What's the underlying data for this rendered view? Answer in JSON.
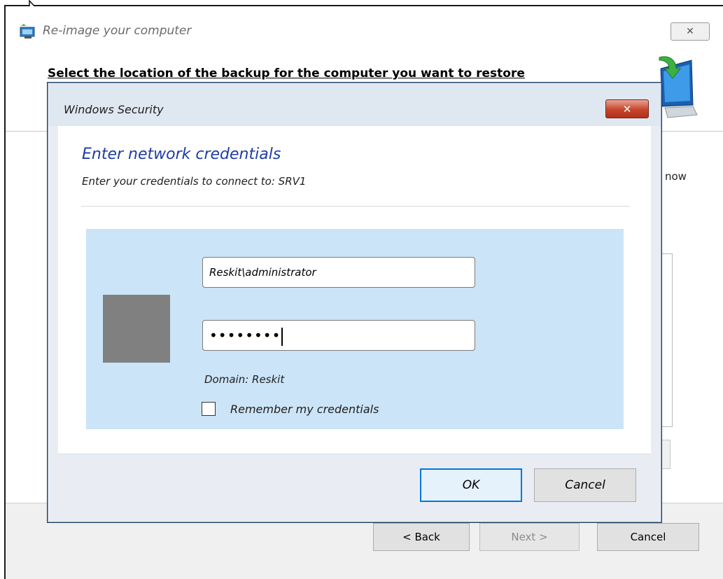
{
  "background_window": {
    "title": "Re-image your computer",
    "close_glyph": "✕",
    "heading": "Select the location of the backup for the computer you want to restore",
    "partial_text": "now",
    "buttons": {
      "back": "< Back",
      "next": "Next >",
      "cancel": "Cancel"
    }
  },
  "dialog": {
    "title": "Windows Security",
    "close_glyph": "✕",
    "heading": "Enter network credentials",
    "subheading": "Enter your credentials to connect to: SRV1",
    "username_value": "Reskit\\administrator",
    "password_mask": "••••••••",
    "domain_text": "Domain: Reskit",
    "remember_label": "Remember my credentials",
    "remember_checked": false,
    "ok_label": "OK",
    "cancel_label": "Cancel"
  },
  "colors": {
    "heading_blue": "#1f3da3",
    "panel_blue": "#cce4f7",
    "close_red": "#c7442b",
    "ok_border": "#0078d7"
  },
  "icons": [
    "window-app-icon",
    "computer-restore-icon",
    "close-icon",
    "user-tile-icon",
    "mouse-cursor-icon"
  ]
}
